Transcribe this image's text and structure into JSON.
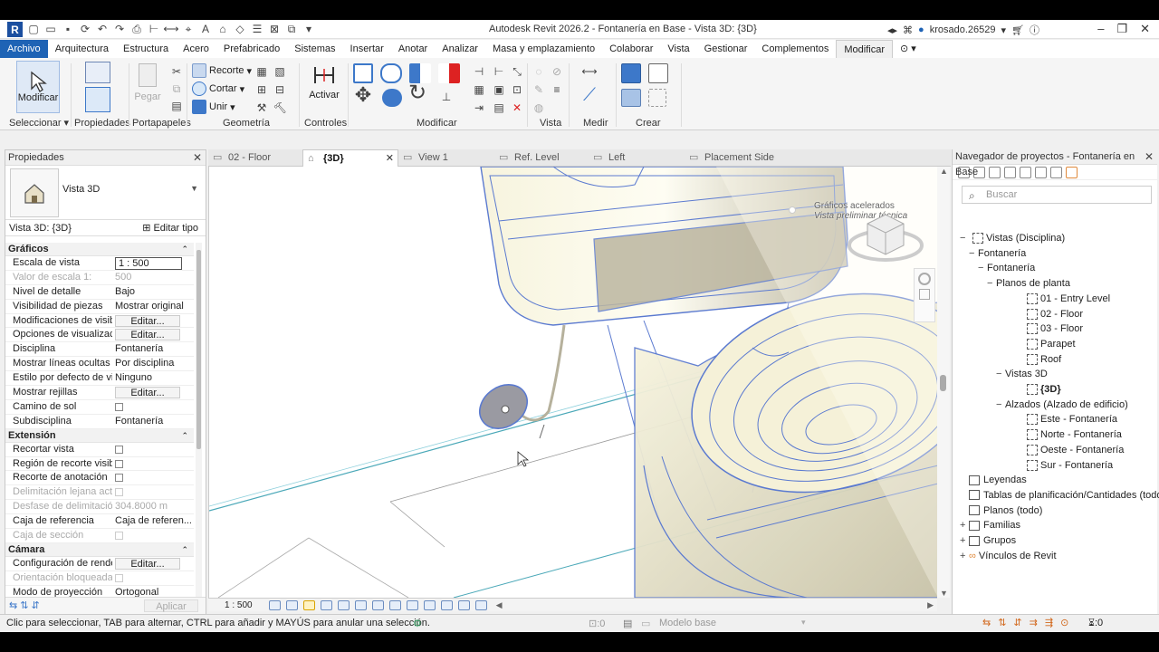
{
  "app": {
    "title": "Autodesk Revit 2026.2 - Fontanería en Base - Vista 3D: {3D}",
    "logo_letter": "R",
    "user": "krosado.26529"
  },
  "menu": {
    "tabs": [
      "Archivo",
      "Arquitectura",
      "Estructura",
      "Acero",
      "Prefabricado",
      "Sistemas",
      "Insertar",
      "Anotar",
      "Analizar",
      "Masa y emplazamiento",
      "Colaborar",
      "Vista",
      "Gestionar",
      "Complementos",
      "Modificar"
    ],
    "active": "Modificar"
  },
  "ribbon": {
    "modificar_label": "Modificar",
    "pegar_label": "Pegar",
    "recorte_label": "Recorte",
    "cortar_label": "Cortar",
    "unir_label": "Unir",
    "activar_label": "Activar",
    "groups": {
      "seleccionar": "Seleccionar",
      "propiedades": "Propiedades",
      "portapapeles": "Portapapeles",
      "geometria": "Geometría",
      "controles": "Controles",
      "modificar": "Modificar",
      "vista": "Vista",
      "medir": "Medir",
      "crear": "Crear"
    }
  },
  "properties": {
    "title": "Propiedades",
    "type_name": "Vista 3D",
    "view_label": "Vista 3D: {3D}",
    "edit_type": "Editar tipo",
    "apply": "Aplicar",
    "sections": [
      {
        "name": "Gráficos",
        "rows": [
          {
            "name": "Escala de vista",
            "value": "1 : 500",
            "kind": "input"
          },
          {
            "name": "Valor de escala    1:",
            "value": "500",
            "kind": "text",
            "dim": true
          },
          {
            "name": "Nivel de detalle",
            "value": "Bajo",
            "kind": "text"
          },
          {
            "name": "Visibilidad de piezas",
            "value": "Mostrar original",
            "kind": "text"
          },
          {
            "name": "Modificaciones de visib...",
            "value": "Editar...",
            "kind": "button"
          },
          {
            "name": "Opciones de visualizaci...",
            "value": "Editar...",
            "kind": "button"
          },
          {
            "name": "Disciplina",
            "value": "Fontanería",
            "kind": "text"
          },
          {
            "name": "Mostrar líneas ocultas",
            "value": "Por disciplina",
            "kind": "text"
          },
          {
            "name": "Estilo por defecto de vi...",
            "value": "Ninguno",
            "kind": "text"
          },
          {
            "name": "Mostrar rejillas",
            "value": "Editar...",
            "kind": "button"
          },
          {
            "name": "Camino de sol",
            "value": "",
            "kind": "check"
          },
          {
            "name": "Subdisciplina",
            "value": "Fontanería",
            "kind": "text"
          }
        ]
      },
      {
        "name": "Extensión",
        "rows": [
          {
            "name": "Recortar vista",
            "value": "",
            "kind": "check"
          },
          {
            "name": "Región de recorte visible",
            "value": "",
            "kind": "check"
          },
          {
            "name": "Recorte de anotación",
            "value": "",
            "kind": "check"
          },
          {
            "name": "Delimitación lejana acti...",
            "value": "",
            "kind": "check",
            "dim": true
          },
          {
            "name": "Desfase de delimitació...",
            "value": "304.8000 m",
            "kind": "text",
            "dim": true
          },
          {
            "name": "Caja de referencia",
            "value": "Caja de referen...",
            "kind": "text"
          },
          {
            "name": "Caja de sección",
            "value": "",
            "kind": "check",
            "dim": true
          }
        ]
      },
      {
        "name": "Cámara",
        "rows": [
          {
            "name": "Configuración de rende...",
            "value": "Editar...",
            "kind": "button"
          },
          {
            "name": "Orientación bloqueada",
            "value": "",
            "kind": "check",
            "dim": true
          },
          {
            "name": "Modo de proyección",
            "value": "Ortogonal",
            "kind": "text"
          }
        ]
      }
    ]
  },
  "view_tabs": [
    {
      "label": "02 - Floor"
    },
    {
      "label": "{3D}",
      "active": true
    },
    {
      "label": "View 1"
    },
    {
      "label": "Ref. Level"
    },
    {
      "label": "Left"
    },
    {
      "label": "Placement Side"
    }
  ],
  "viewport": {
    "overlay_line1": "Gráficos acelerados",
    "overlay_line2": "Vista preliminar técnica",
    "scale": "1 : 500"
  },
  "browser": {
    "title": "Navegador de proyectos - Fontanería en Base",
    "search_placeholder": "Buscar",
    "nodes": [
      {
        "label": "Vistas (Disciplina)",
        "toggle": "−",
        "icon": "views"
      },
      {
        "label": "Fontanería",
        "toggle": "−"
      },
      {
        "label": "Fontanería",
        "toggle": "−"
      },
      {
        "label": "Planos de planta",
        "toggle": "−"
      },
      {
        "label": "01 - Entry Level",
        "icon": "view"
      },
      {
        "label": "02 - Floor",
        "icon": "view"
      },
      {
        "label": "03 - Floor",
        "icon": "view"
      },
      {
        "label": "Parapet",
        "icon": "view"
      },
      {
        "label": "Roof",
        "icon": "view"
      },
      {
        "label": "Vistas 3D",
        "toggle": "−"
      },
      {
        "label": "{3D}",
        "icon": "view",
        "bold": true
      },
      {
        "label": "Alzados (Alzado de edificio)",
        "toggle": "−"
      },
      {
        "label": "Este - Fontanería",
        "icon": "view"
      },
      {
        "label": "Norte - Fontanería",
        "icon": "view"
      },
      {
        "label": "Oeste - Fontanería",
        "icon": "view"
      },
      {
        "label": "Sur - Fontanería",
        "icon": "view"
      },
      {
        "label": "Leyendas",
        "icon": "folder"
      },
      {
        "label": "Tablas de planificación/Cantidades (todo)",
        "icon": "folder"
      },
      {
        "label": "Planos (todo)",
        "icon": "folder"
      },
      {
        "label": "Familias",
        "toggle": "+",
        "icon": "folder"
      },
      {
        "label": "Grupos",
        "toggle": "+",
        "icon": "folder"
      },
      {
        "label": "Vínculos de Revit",
        "toggle": "+",
        "icon": "link"
      }
    ]
  },
  "status": {
    "text": "Clic para seleccionar, TAB para alternar, CTRL para añadir y MAYÚS para anular una selección.",
    "selection_count": ":0",
    "model": "Modelo base",
    "filter_count": ":0"
  }
}
